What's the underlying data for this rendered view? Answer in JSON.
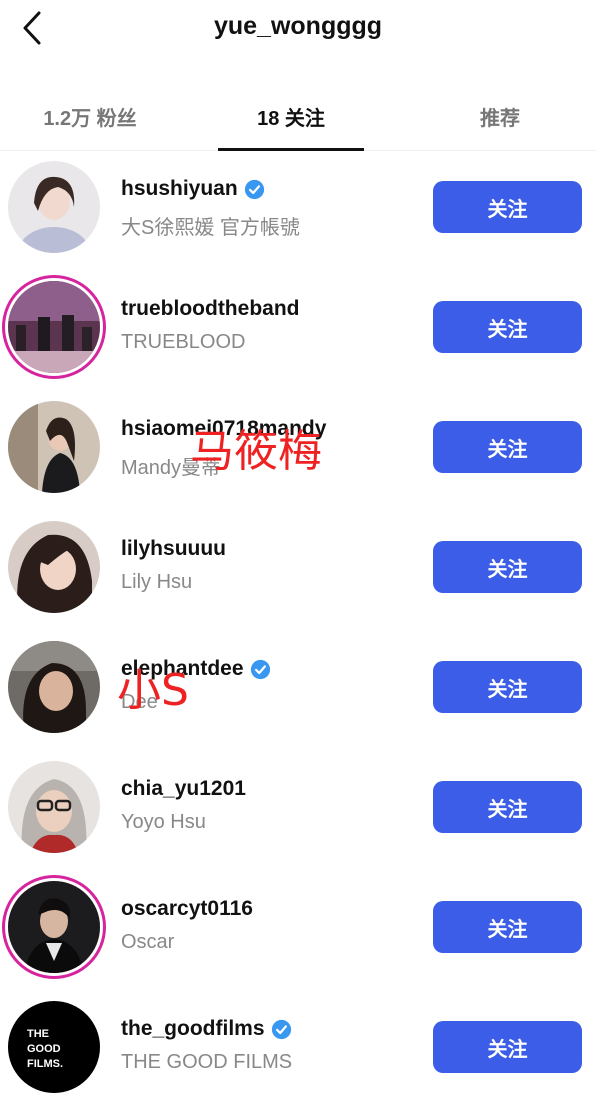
{
  "header": {
    "title": "yue_wongggg",
    "back_icon": "chevron-left-icon"
  },
  "tabs": [
    {
      "label": "1.2万 粉丝",
      "active": false
    },
    {
      "label": "18 关注",
      "active": true
    },
    {
      "label": "推荐",
      "active": false
    }
  ],
  "accent_color": "#3b5de7",
  "verified_color": "#3897f0",
  "users": [
    {
      "username": "hsushiyuan",
      "full_name": "大S徐熙媛 官方帳號",
      "verified": true,
      "button": "关注"
    },
    {
      "username": "truebloodtheband",
      "full_name": "TRUEBLOOD",
      "verified": false,
      "button": "关注"
    },
    {
      "username": "hsiaomei0718mandy",
      "full_name": "Mandy曼蒂",
      "verified": false,
      "button": "关注"
    },
    {
      "username": "lilyhsuuuu",
      "full_name": "Lily Hsu",
      "verified": false,
      "button": "关注"
    },
    {
      "username": "elephantdee",
      "full_name": "Dee",
      "verified": true,
      "button": "关注"
    },
    {
      "username": "chia_yu1201",
      "full_name": "Yoyo Hsu",
      "verified": false,
      "button": "关注"
    },
    {
      "username": "oscarcyt0116",
      "full_name": "Oscar",
      "verified": false,
      "button": "关注"
    },
    {
      "username": "the_goodfilms",
      "full_name": "THE GOOD FILMS",
      "verified": true,
      "button": "关注"
    }
  ],
  "annotations": [
    "马筱梅",
    "小S"
  ],
  "goodfilms_logo_text": [
    "THE",
    "GOOD",
    "FILMS."
  ]
}
